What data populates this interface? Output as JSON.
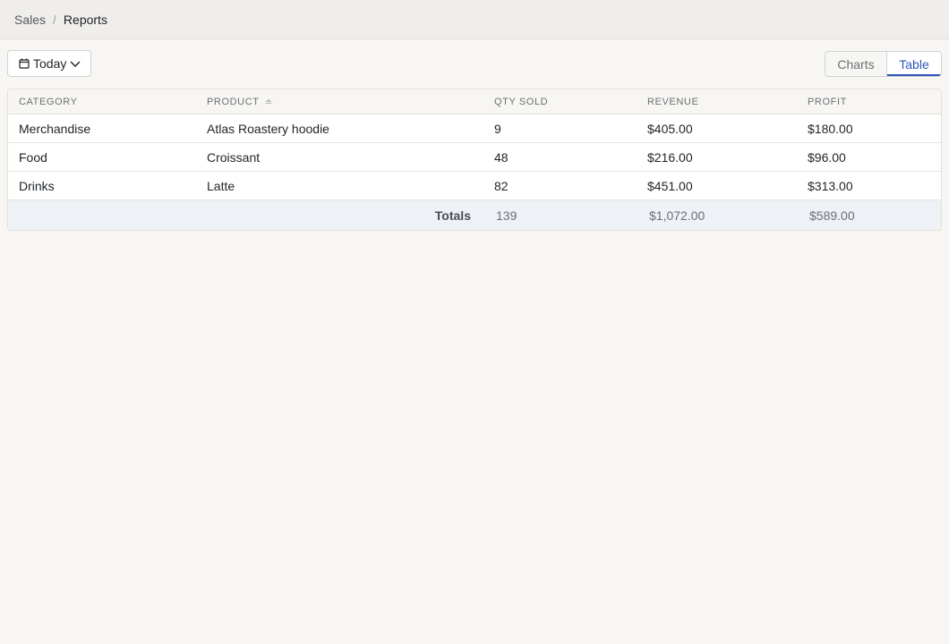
{
  "breadcrumb": {
    "root": "Sales",
    "separator": "/",
    "current": "Reports"
  },
  "toolbar": {
    "date_label": "Today",
    "view_options": [
      "Charts",
      "Table"
    ],
    "active_view": "Table"
  },
  "table": {
    "columns": [
      "CATEGORY",
      "PRODUCT",
      "QTY SOLD",
      "REVENUE",
      "PROFIT"
    ],
    "sort_column": "PRODUCT",
    "sort_direction": "ascending",
    "rows": [
      [
        "Merchandise",
        "Atlas Roastery hoodie",
        "9",
        "$405.00",
        "$180.00"
      ],
      [
        "Food",
        "Croissant",
        "48",
        "$216.00",
        "$96.00"
      ],
      [
        "Drinks",
        "Latte",
        "82",
        "$451.00",
        "$313.00"
      ]
    ],
    "totals": {
      "label": "Totals",
      "qty": "139",
      "revenue": "$1,072.00",
      "profit": "$589.00"
    }
  },
  "colors": {
    "accent": "#2d55b8",
    "background": "#f7f6f2",
    "totals_bg": "#eef1f5"
  }
}
